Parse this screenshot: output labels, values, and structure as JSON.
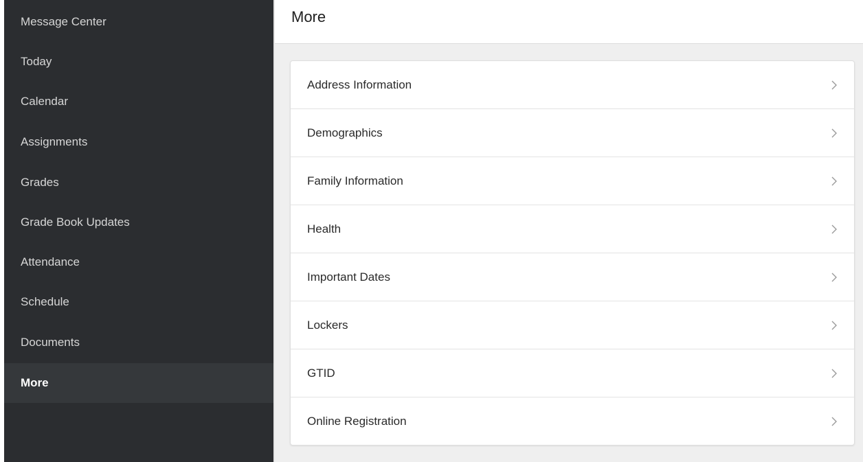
{
  "sidebar": {
    "items": [
      {
        "label": "Message Center"
      },
      {
        "label": "Today"
      },
      {
        "label": "Calendar"
      },
      {
        "label": "Assignments"
      },
      {
        "label": "Grades"
      },
      {
        "label": "Grade Book Updates"
      },
      {
        "label": "Attendance"
      },
      {
        "label": "Schedule"
      },
      {
        "label": "Documents"
      },
      {
        "label": "More",
        "active": true
      }
    ]
  },
  "header": {
    "title": "More"
  },
  "list": {
    "items": [
      {
        "label": "Address Information",
        "icon": "chevron-right-icon"
      },
      {
        "label": "Demographics",
        "icon": "chevron-right-icon"
      },
      {
        "label": "Family Information",
        "icon": "chevron-right-icon"
      },
      {
        "label": "Health",
        "icon": "chevron-right-icon"
      },
      {
        "label": "Important Dates",
        "icon": "chevron-right-icon"
      },
      {
        "label": "Lockers",
        "icon": "chevron-right-icon"
      },
      {
        "label": "GTID",
        "icon": "chevron-right-icon"
      },
      {
        "label": "Online Registration",
        "icon": "chevron-right-icon"
      }
    ]
  },
  "colors": {
    "sidebar_bg": "#2b2d30",
    "sidebar_active_bg": "#35383b",
    "main_bg": "#efefef",
    "card_bg": "#ffffff"
  }
}
